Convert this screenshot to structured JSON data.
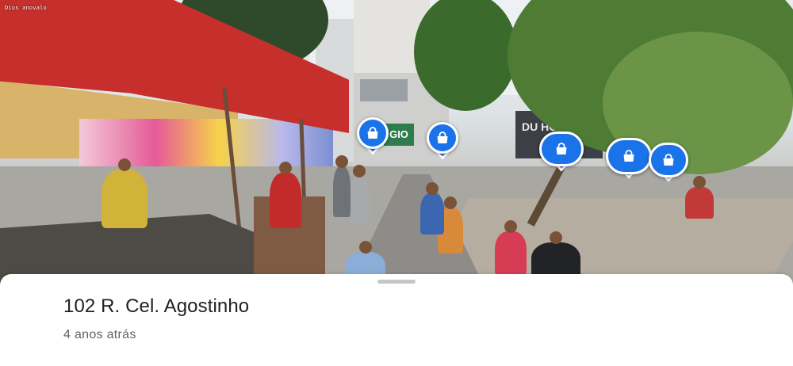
{
  "panorama": {
    "watermark": "Dios anovalo",
    "shop_sign": "GIO",
    "storefront_sign": "DU HC..."
  },
  "markers": [
    {
      "icon": "shopping-bag-icon",
      "color": "#1a73e8"
    },
    {
      "icon": "shopping-bag-icon",
      "color": "#1a73e8"
    },
    {
      "icon": "shopping-bag-icon",
      "color": "#1a73e8"
    },
    {
      "icon": "shopping-bag-icon",
      "color": "#1a73e8"
    },
    {
      "icon": "shopping-bag-icon",
      "color": "#1a73e8"
    }
  ],
  "info_sheet": {
    "address": "102 R. Cel. Agostinho",
    "capture_date": "4 anos atrás"
  },
  "colors": {
    "accent": "#1a73e8",
    "primary_text": "#202124",
    "secondary_text": "#5f6368"
  }
}
